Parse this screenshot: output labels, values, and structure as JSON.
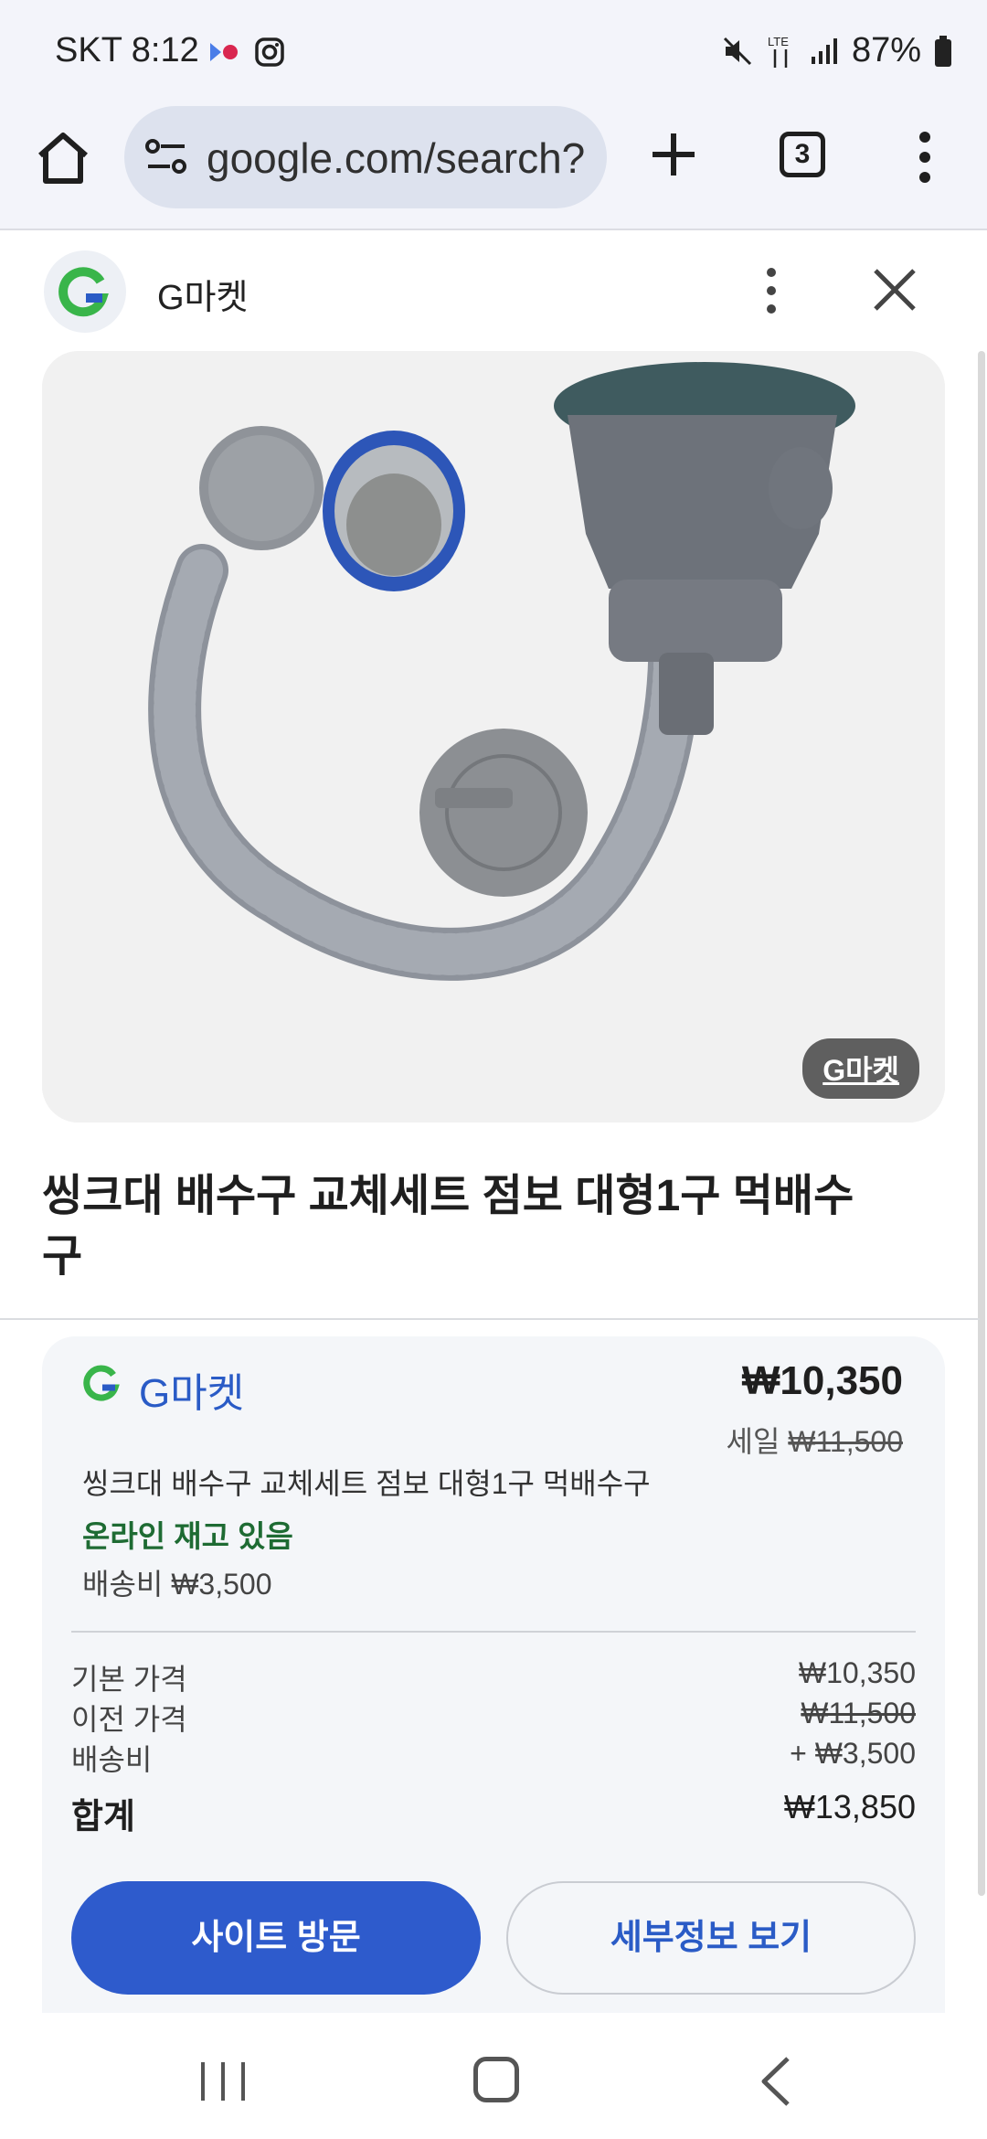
{
  "status_bar": {
    "time": "SKT 8:12",
    "battery": "87%",
    "network": "LTE",
    "icons": [
      "media-dot-icon",
      "instagram-icon",
      "mute-icon",
      "lte-icon",
      "signal-icon",
      "battery-icon"
    ]
  },
  "browser": {
    "url": "google.com/search?",
    "tab_count": "3",
    "icons": [
      "home-icon",
      "site-settings-icon",
      "new-tab-icon",
      "tabs-icon",
      "menu-icon"
    ]
  },
  "sheet": {
    "title": "G마켓",
    "icons": [
      "gmarket-logo-icon",
      "more-icon",
      "close-icon"
    ]
  },
  "product": {
    "image_badge": "G마켓",
    "title": "씽크대 배수구 교체세트 점보 대형1구 먹배수구"
  },
  "offer": {
    "merchant": "G마켓",
    "price": "₩10,350",
    "sale_label": "세일",
    "original_price": "₩11,500",
    "description": "씽크대 배수구 교체세트 점보 대형1구 먹배수구",
    "stock": "온라인 재고 있음",
    "shipping": "배송비 ₩3,500",
    "breakdown": [
      {
        "label": "기본 가격",
        "value": "₩10,350"
      },
      {
        "label": "이전 가격",
        "value": "₩11,500"
      },
      {
        "label": "배송비",
        "value": "+ ₩3,500"
      }
    ],
    "total_label": "합계",
    "total_value": "₩13,850",
    "visit_button": "사이트 방문",
    "details_button": "세부정보 보기"
  },
  "nav_bar": {
    "icons": [
      "recent-apps-icon",
      "home-button-icon",
      "back-icon"
    ]
  },
  "colors": {
    "accent": "#2e5bcc",
    "stock_green": "#1e6b33",
    "toolbar_bg": "#f3f4fa",
    "card_bg": "#f4f6f9"
  }
}
